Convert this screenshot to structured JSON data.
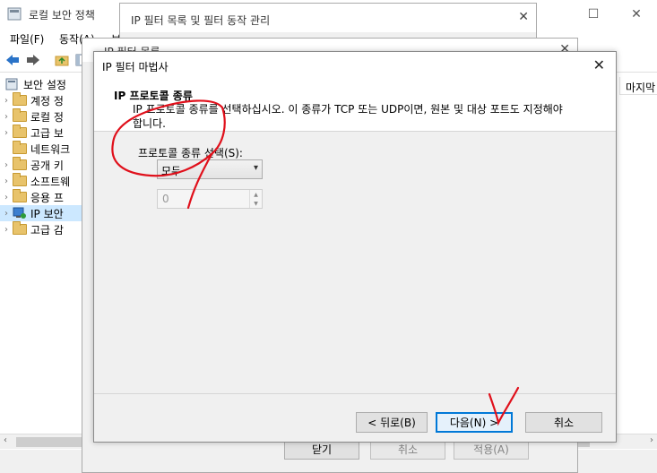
{
  "main": {
    "title": "로컬 보안 정책",
    "menu": [
      "파일(F)",
      "동작(A)",
      "보"
    ],
    "tree": [
      {
        "label": "보안 설정",
        "arrow": ""
      },
      {
        "label": "계정 정",
        "arrow": "›"
      },
      {
        "label": "로컬 정",
        "arrow": "›"
      },
      {
        "label": "고급 보",
        "arrow": "›"
      },
      {
        "label": "네트워크",
        "arrow": ""
      },
      {
        "label": "공개 키",
        "arrow": "›"
      },
      {
        "label": "소프트웨",
        "arrow": "›"
      },
      {
        "label": "응용 프",
        "arrow": "›"
      },
      {
        "label": "IP 보안",
        "arrow": "›"
      },
      {
        "label": "고급 감",
        "arrow": "›"
      }
    ],
    "column_header": "마지막"
  },
  "filter_list": {
    "title": "IP 필터 목록 및 필터 동작 관리"
  },
  "filter_props": {
    "title": "IP 필터 목록",
    "close_label": "닫기",
    "cancel_label": "취소",
    "apply_label": "적용(A)"
  },
  "wizard": {
    "title": "IP 필터 마법사",
    "header_title": "IP 프로토콜 종류",
    "header_desc": "IP 프로토콜 종류를 선택하십시오. 이 종류가 TCP 또는 UDP이면, 원본 및 대상 포트도 지정해야 합니다.",
    "protocol_label": "프로토콜 종류 선택(S):",
    "protocol_value": "모두",
    "port_value": "0",
    "back_label": "< 뒤로(B)",
    "next_label": "다음(N) >",
    "cancel_label": "취소"
  },
  "colors": {
    "accent": "#0078d7",
    "annotation": "#e0101b"
  }
}
